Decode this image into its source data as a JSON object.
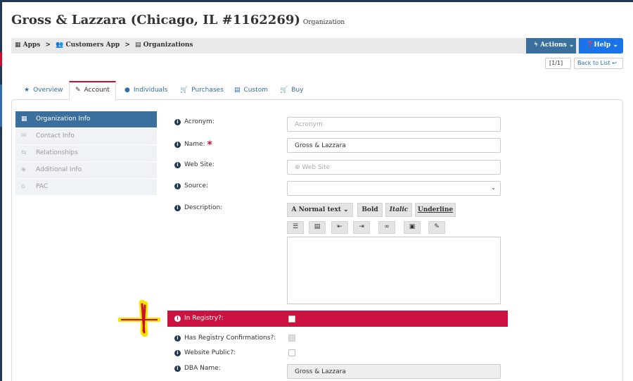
{
  "header": {
    "title": "Gross & Lazzara (Chicago, IL #1162269)",
    "subtitle": "Organization"
  },
  "breadcrumb": {
    "apps": "Apps",
    "customers_app": "Customers App",
    "organizations": "Organizations",
    "separator": ">"
  },
  "toolbar": {
    "actions_label": "Actions",
    "help_label": "Help",
    "pager_label": "[1/1]",
    "back_label": "Back to List"
  },
  "tabs": [
    {
      "label": "Overview",
      "icon": "star-icon"
    },
    {
      "label": "Account",
      "icon": "edit-icon",
      "active": true
    },
    {
      "label": "Individuals",
      "icon": "user-icon"
    },
    {
      "label": "Purchases",
      "icon": "cart-icon"
    },
    {
      "label": "Custom",
      "icon": "file-icon"
    },
    {
      "label": "Buy",
      "icon": "cart-icon"
    }
  ],
  "sidebar": {
    "items": [
      {
        "label": "Organization Info",
        "icon": "building-icon",
        "active": true
      },
      {
        "label": "Contact Info",
        "icon": "envelope-icon"
      },
      {
        "label": "Relationships",
        "icon": "exchange-icon"
      },
      {
        "label": "Additional Info",
        "icon": "tag-icon"
      },
      {
        "label": "PAC",
        "icon": "bank-icon"
      }
    ]
  },
  "form": {
    "acronym": {
      "label": "Acronym:",
      "placeholder": "Acronym",
      "value": ""
    },
    "name": {
      "label": "Name:",
      "value": "Gross & Lazzara",
      "required_mark": "*"
    },
    "website": {
      "label": "Web Site:",
      "placeholder": "Web Site"
    },
    "source": {
      "label": "Source:",
      "value": ""
    },
    "description": {
      "label": "Description:"
    },
    "in_registry": {
      "label": "In Registry?:",
      "checked": false
    },
    "has_registry_confirmations": {
      "label": "Has Registry Confirmations?:",
      "checked": false
    },
    "website_public": {
      "label": "Website Public?:",
      "checked": false
    },
    "dba_name": {
      "label": "DBA Name:",
      "value": "Gross & Lazzara"
    }
  },
  "editor_toolbar": {
    "format_label": "Normal text",
    "bold_label": "Bold",
    "italic_label": "Italic",
    "underline_label": "Underline",
    "tools": [
      "bullet-list-icon",
      "numbered-list-icon",
      "outdent-icon",
      "indent-icon",
      "link-icon",
      "image-icon",
      "clear-format-icon"
    ]
  },
  "colors": {
    "primary": "#3a6f9e",
    "help_button": "#1a73e8",
    "highlight_row": "#cc1240",
    "marker_red": "#c8102e",
    "marker_yellow": "#f5e400"
  }
}
